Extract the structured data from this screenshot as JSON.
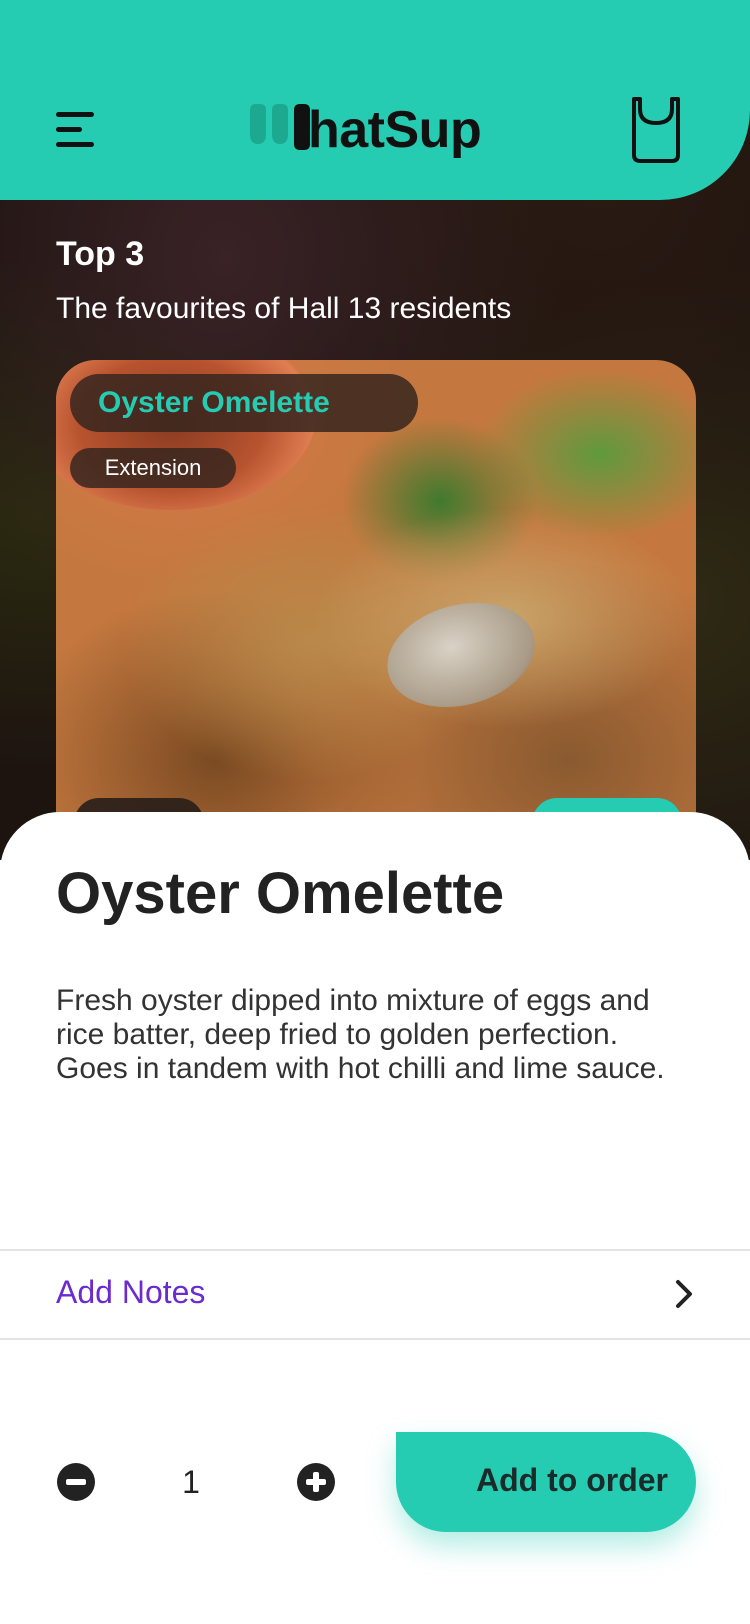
{
  "header": {
    "logo_text": "hatSup",
    "brand_color": "#26ccb2",
    "menu_icon": "menu-icon",
    "cart_icon": "shopping-bag-icon"
  },
  "section": {
    "title": "Top 3",
    "subtitle": "The favourites of Hall 13 residents"
  },
  "featured_card": {
    "name": "Oyster Omelette",
    "tag": "Extension"
  },
  "item": {
    "title": "Oyster Omelette",
    "description": "Fresh oyster dipped into mixture of eggs and rice batter, deep fried to golden perfection. Goes in tandem with hot chilli and lime sauce."
  },
  "notes": {
    "label": "Add Notes"
  },
  "order": {
    "quantity": "1",
    "add_label": "Add to order"
  },
  "colors": {
    "accent": "#26ccb2",
    "link": "#6a2bd1"
  }
}
